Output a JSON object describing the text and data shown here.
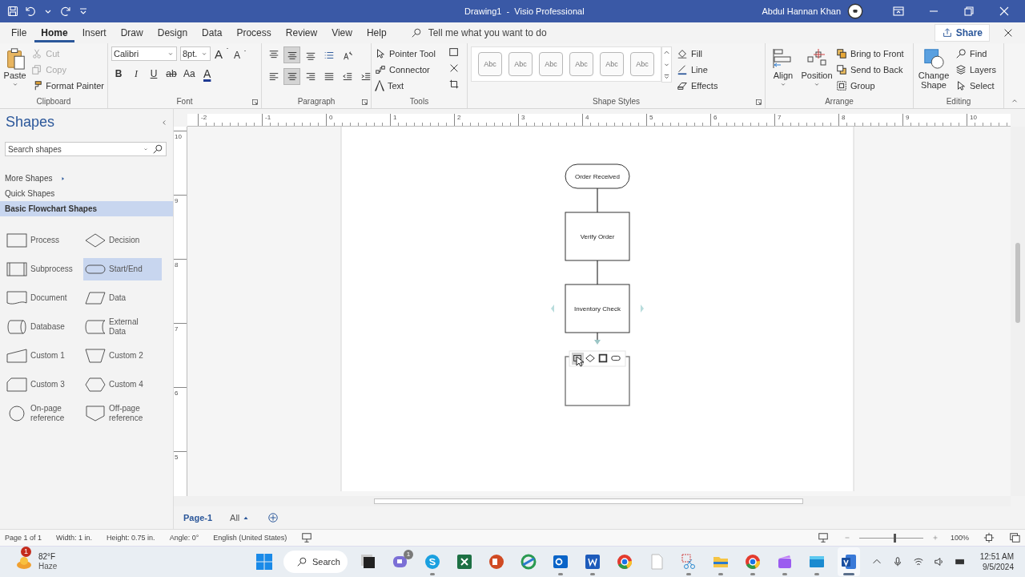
{
  "title_bar": {
    "title": "Drawing1  -  Visio Professional",
    "user": "Abdul Hannan Khan"
  },
  "menu_tabs": [
    {
      "label": "File",
      "selected": false
    },
    {
      "label": "Home",
      "selected": true
    },
    {
      "label": "Insert",
      "selected": false
    },
    {
      "label": "Draw",
      "selected": false
    },
    {
      "label": "Design",
      "selected": false
    },
    {
      "label": "Data",
      "selected": false
    },
    {
      "label": "Process",
      "selected": false
    },
    {
      "label": "Review",
      "selected": false
    },
    {
      "label": "View",
      "selected": false
    },
    {
      "label": "Help",
      "selected": false
    }
  ],
  "tell_me": {
    "placeholder": "Tell me what you want to do"
  },
  "share": "Share",
  "ribbon": {
    "clipboard": {
      "label": "Clipboard",
      "paste": "Paste",
      "commands": [
        {
          "label": "Cut",
          "kind": "cut",
          "disabled": true
        },
        {
          "label": "Copy",
          "kind": "copy",
          "disabled": true
        },
        {
          "label": "Format Painter",
          "kind": "painter",
          "disabled": false
        }
      ]
    },
    "font": {
      "label": "Font",
      "font_name": "Calibri",
      "font_size": "8pt.",
      "size_buttons": [
        {
          "label": "A",
          "kind": "grow"
        },
        {
          "label": "A",
          "kind": "shrink"
        }
      ],
      "format_buttons": [
        {
          "label": "B",
          "kind": "bold"
        },
        {
          "label": "I",
          "kind": "italic"
        },
        {
          "label": "U",
          "kind": "underline"
        },
        {
          "label": "ab",
          "kind": "strike"
        },
        {
          "label": "Aa",
          "kind": "case"
        },
        {
          "label": "A",
          "kind": "color"
        }
      ]
    },
    "paragraph": {
      "label": "Paragraph",
      "top_row": [
        {
          "kind": "align-top",
          "selected": false
        },
        {
          "kind": "align-middle",
          "selected": true
        },
        {
          "kind": "align-bottom",
          "selected": false
        },
        {
          "kind": "bullets",
          "selected": false
        },
        {
          "kind": "text-direction",
          "selected": false
        }
      ],
      "bottom_row": [
        {
          "kind": "align-left",
          "selected": false
        },
        {
          "kind": "align-center",
          "selected": true
        },
        {
          "kind": "align-right",
          "selected": false
        },
        {
          "kind": "justify",
          "selected": false
        },
        {
          "kind": "indent-less",
          "selected": false
        },
        {
          "kind": "indent-more",
          "selected": false
        }
      ]
    },
    "tools": {
      "label": "Tools",
      "items": [
        {
          "label": "Pointer Tool",
          "kind": "pointer"
        },
        {
          "label": "Connector",
          "kind": "connector"
        },
        {
          "label": "Text",
          "kind": "text"
        }
      ]
    },
    "shape_styles": {
      "label": "Shape Styles",
      "swatches": [
        "Abc",
        "Abc",
        "Abc",
        "Abc",
        "Abc",
        "Abc"
      ],
      "commands": [
        {
          "label": "Fill",
          "kind": "fill"
        },
        {
          "label": "Line",
          "kind": "line"
        },
        {
          "label": "Effects",
          "kind": "effects"
        }
      ]
    },
    "arrange": {
      "label": "Arrange",
      "large": [
        {
          "label": "Align",
          "kind": "align"
        },
        {
          "label": "Position",
          "kind": "position"
        }
      ],
      "commands": [
        {
          "label": "Bring to Front",
          "kind": "front"
        },
        {
          "label": "Send to Back",
          "kind": "back"
        },
        {
          "label": "Group",
          "kind": "group"
        }
      ]
    },
    "editing": {
      "label": "Editing",
      "change_shape": "Change Shape",
      "commands": [
        {
          "label": "Find",
          "kind": "find"
        },
        {
          "label": "Layers",
          "kind": "layers"
        },
        {
          "label": "Select",
          "kind": "select"
        }
      ]
    }
  },
  "shapes_pane": {
    "title": "Shapes",
    "search": {
      "placeholder": "Search shapes"
    },
    "links": [
      {
        "label": "More Shapes",
        "selected": false
      },
      {
        "label": "Quick Shapes",
        "selected": false
      },
      {
        "label": "Basic Flowchart Shapes",
        "selected": true
      }
    ],
    "stencil": [
      {
        "label": "Process",
        "kind": "process",
        "selected": false
      },
      {
        "label": "Decision",
        "kind": "decision",
        "selected": false
      },
      {
        "label": "Subprocess",
        "kind": "subprocess",
        "selected": false
      },
      {
        "label": "Start/End",
        "kind": "terminator",
        "selected": true
      },
      {
        "label": "Document",
        "kind": "document",
        "selected": false
      },
      {
        "label": "Data",
        "kind": "data",
        "selected": false
      },
      {
        "label": "Database",
        "kind": "database",
        "selected": false
      },
      {
        "label": "External Data",
        "kind": "external",
        "selected": false
      },
      {
        "label": "Custom 1",
        "kind": "custom1",
        "selected": false
      },
      {
        "label": "Custom 2",
        "kind": "custom2",
        "selected": false
      },
      {
        "label": "Custom 3",
        "kind": "custom3",
        "selected": false
      },
      {
        "label": "Custom 4",
        "kind": "custom4",
        "selected": false
      },
      {
        "label": "On-page reference",
        "kind": "onpage",
        "selected": false
      },
      {
        "label": "Off-page reference",
        "kind": "offpage",
        "selected": false
      }
    ]
  },
  "rulers": {
    "horizontal": [
      "-2",
      "-1",
      "0",
      "1",
      "2",
      "3",
      "4",
      "5",
      "6",
      "7",
      "8",
      "9",
      "10"
    ],
    "vertical": [
      "10",
      "9",
      "8",
      "7",
      "6",
      "5"
    ]
  },
  "diagram": {
    "nodes": [
      {
        "label": "Order Received",
        "kind": "terminator"
      },
      {
        "label": "Verify Order",
        "kind": "process"
      },
      {
        "label": "Inventory Check",
        "kind": "process"
      },
      {
        "kind": "new"
      }
    ],
    "quick_shapes": [
      {
        "kind": "process",
        "selected": true
      },
      {
        "kind": "decision",
        "selected": false
      },
      {
        "kind": "subprocess",
        "selected": false
      },
      {
        "kind": "terminator",
        "selected": false
      }
    ]
  },
  "page_tabs": [
    {
      "label": "Page-1",
      "selected": true
    },
    {
      "label": "All",
      "selected": false
    }
  ],
  "status_bar": {
    "items": [
      "Page 1 of 1",
      "Width: 1 in.",
      "Height: 0.75 in.",
      "Angle: 0°",
      "English (United States)"
    ],
    "zoom": {
      "level": 0.55,
      "reading": "100%"
    }
  },
  "taskbar": {
    "weather": {
      "temp": "82°F",
      "condition": "Haze",
      "badge": "1"
    },
    "search": "Search",
    "apps": [
      {
        "kind": "taskview",
        "selected": false,
        "running": false
      },
      {
        "kind": "chat",
        "selected": false,
        "running": false,
        "badge": "1"
      },
      {
        "kind": "skype",
        "selected": false,
        "running": true
      },
      {
        "kind": "sheet",
        "selected": false,
        "running": false
      },
      {
        "kind": "slides",
        "selected": false,
        "running": false
      },
      {
        "kind": "sync",
        "selected": false,
        "running": false
      },
      {
        "kind": "mail",
        "selected": false,
        "running": true
      },
      {
        "kind": "doc",
        "selected": false,
        "running": true
      },
      {
        "kind": "browser",
        "selected": false,
        "running": false
      },
      {
        "kind": "file",
        "selected": false,
        "running": false
      },
      {
        "kind": "snip",
        "selected": false,
        "running": true
      },
      {
        "kind": "folder",
        "selected": false,
        "running": true
      },
      {
        "kind": "browser",
        "selected": false,
        "running": true
      },
      {
        "kind": "clapper",
        "selected": false,
        "running": true
      },
      {
        "kind": "window",
        "selected": false,
        "running": true
      },
      {
        "kind": "diagram",
        "selected": true,
        "running": true
      }
    ],
    "time": "12:51 AM",
    "date": "9/5/2024"
  }
}
